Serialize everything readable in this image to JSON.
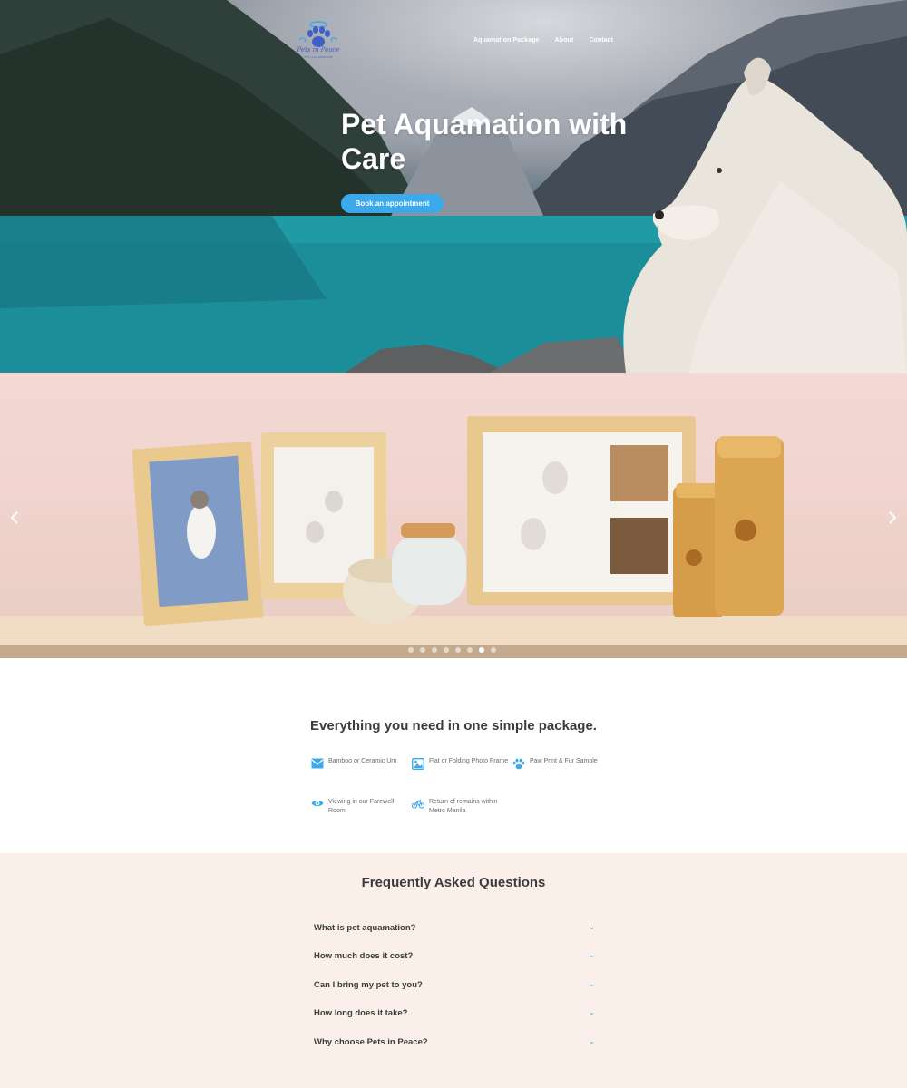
{
  "brand": {
    "logo_text": "Pets in Peace",
    "logo_subtext": "PET AQUAMATION",
    "logo_icon": "paw-halo-icon",
    "color_primary": "#3ba9ec",
    "color_logo": "#3d5fc8"
  },
  "nav": {
    "items": [
      {
        "label": "Aquamation Package"
      },
      {
        "label": "About"
      },
      {
        "label": "Contact"
      }
    ]
  },
  "hero": {
    "title": "Pet Aquamation with Care",
    "cta_label": "Book an appointment"
  },
  "carousel": {
    "prev_icon": "chevron-left-icon",
    "next_icon": "chevron-right-icon",
    "slide_count": 8,
    "active_index": 6
  },
  "package": {
    "heading": "Everything you need in one simple package.",
    "features": [
      {
        "label": "Bamboo or Ceramic Urn",
        "icon": "envelope-icon"
      },
      {
        "label": "Flat or Folding Photo Frame",
        "icon": "photo-icon"
      },
      {
        "label": "Paw Print & Fur Sample",
        "icon": "paw-icon"
      },
      {
        "label": "Viewing in our Farewell Room",
        "icon": "eye-icon"
      },
      {
        "label": "Return of remains within Metro Manila",
        "icon": "bicycle-icon"
      }
    ]
  },
  "faq": {
    "heading": "Frequently Asked Questions",
    "items": [
      {
        "question": "What is pet aquamation?"
      },
      {
        "question": "How much does it cost?"
      },
      {
        "question": "Can I bring my pet to you?"
      },
      {
        "question": "How long does it take?"
      },
      {
        "question": "Why choose Pets in Peace?"
      }
    ]
  }
}
